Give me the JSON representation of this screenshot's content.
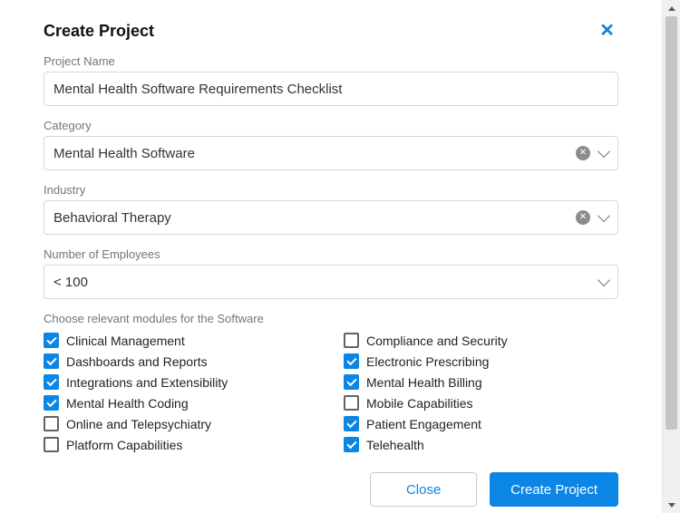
{
  "dialog": {
    "title": "Create Project"
  },
  "fields": {
    "project_name": {
      "label": "Project Name",
      "value": "Mental Health Software Requirements Checklist"
    },
    "category": {
      "label": "Category",
      "value": "Mental Health Software"
    },
    "industry": {
      "label": "Industry",
      "value": "Behavioral Therapy"
    },
    "employees": {
      "label": "Number of Employees",
      "value": "< 100"
    }
  },
  "modules": {
    "label": "Choose relevant modules for the Software",
    "left": [
      {
        "label": "Clinical Management",
        "checked": true
      },
      {
        "label": "Dashboards and Reports",
        "checked": true
      },
      {
        "label": "Integrations and Extensibility",
        "checked": true
      },
      {
        "label": "Mental Health Coding",
        "checked": true
      },
      {
        "label": "Online and Telepsychiatry",
        "checked": false
      },
      {
        "label": "Platform Capabilities",
        "checked": false
      }
    ],
    "right": [
      {
        "label": "Compliance and Security",
        "checked": false
      },
      {
        "label": "Electronic Prescribing",
        "checked": true
      },
      {
        "label": "Mental Health Billing",
        "checked": true
      },
      {
        "label": "Mobile Capabilities",
        "checked": false
      },
      {
        "label": "Patient Engagement",
        "checked": true
      },
      {
        "label": "Telehealth",
        "checked": true
      }
    ]
  },
  "footer": {
    "close": "Close",
    "create": "Create Project"
  }
}
